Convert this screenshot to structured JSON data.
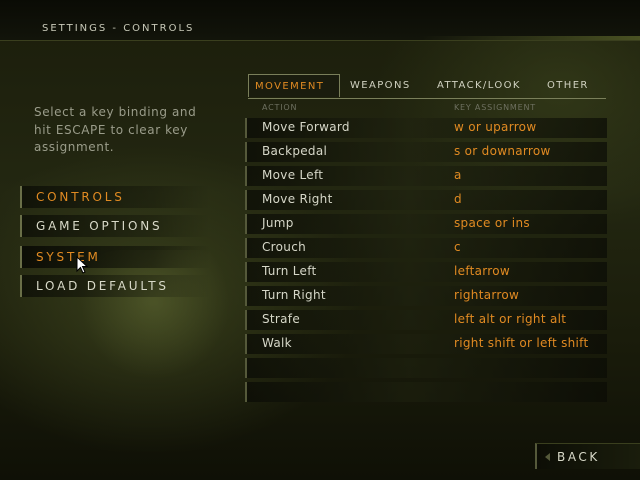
{
  "header": {
    "title": "SETTINGS - CONTROLS"
  },
  "instructions": "Select a key binding and hit ESCAPE to clear key assignment.",
  "menu": {
    "items": [
      {
        "label": "CONTROLS"
      },
      {
        "label": "GAME OPTIONS"
      },
      {
        "label": "SYSTEM"
      },
      {
        "label": "LOAD DEFAULTS"
      }
    ]
  },
  "tabs": [
    {
      "label": "MOVEMENT"
    },
    {
      "label": "WEAPONS"
    },
    {
      "label": "ATTACK/LOOK"
    },
    {
      "label": "OTHER"
    }
  ],
  "columns": {
    "action": "ACTION",
    "key": "KEY ASSIGNMENT"
  },
  "bindings": [
    {
      "action": "Move Forward",
      "key": "w or uparrow"
    },
    {
      "action": "Backpedal",
      "key": "s or downarrow"
    },
    {
      "action": "Move Left",
      "key": "a"
    },
    {
      "action": "Move Right",
      "key": "d"
    },
    {
      "action": "Jump",
      "key": "space or ins"
    },
    {
      "action": "Crouch",
      "key": "c"
    },
    {
      "action": "Turn Left",
      "key": "leftarrow"
    },
    {
      "action": "Turn Right",
      "key": "rightarrow"
    },
    {
      "action": "Strafe",
      "key": "left alt or right alt"
    },
    {
      "action": "Walk",
      "key": "right shift or left shift"
    },
    {
      "action": "",
      "key": ""
    },
    {
      "action": "",
      "key": ""
    }
  ],
  "back_label": "BACK",
  "colors": {
    "accent": "#e08a22",
    "text": "#d6d7c8"
  }
}
